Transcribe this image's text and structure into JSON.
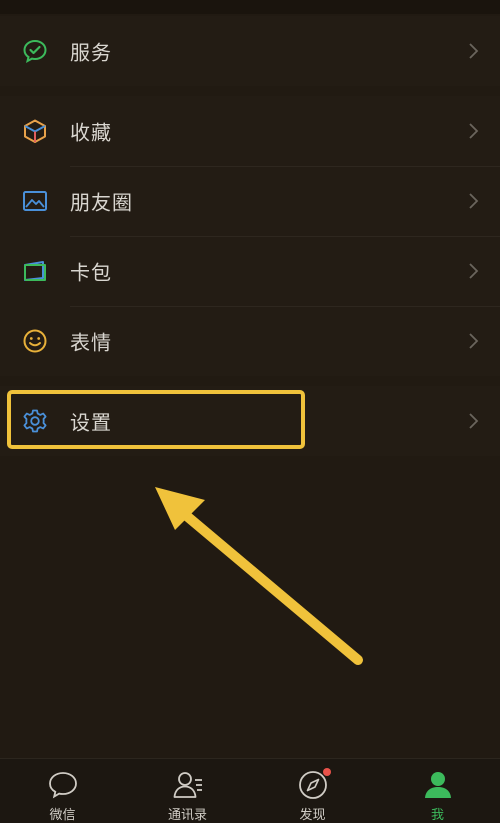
{
  "menu": {
    "services": {
      "label": "服务",
      "icon": "wechat-pay-icon"
    },
    "favorites": {
      "label": "收藏",
      "icon": "cube-icon"
    },
    "moments": {
      "label": "朋友圈",
      "icon": "image-icon"
    },
    "cards": {
      "label": "卡包",
      "icon": "wallet-icon"
    },
    "stickers": {
      "label": "表情",
      "icon": "smiley-icon"
    },
    "settings": {
      "label": "设置",
      "icon": "gear-icon"
    }
  },
  "tabbar": {
    "tabs": [
      {
        "label": "微信",
        "icon": "chat-bubble-icon",
        "active": false
      },
      {
        "label": "通讯录",
        "icon": "contacts-icon",
        "active": false
      },
      {
        "label": "发现",
        "icon": "compass-icon",
        "active": false,
        "badge": true
      },
      {
        "label": "我",
        "icon": "person-icon",
        "active": true
      }
    ]
  },
  "colors": {
    "background": "#211a12",
    "row": "#231c14",
    "text": "#d9d6d0",
    "highlight": "#f0c23b",
    "active": "#3cba5c",
    "badge": "#e9524a"
  }
}
